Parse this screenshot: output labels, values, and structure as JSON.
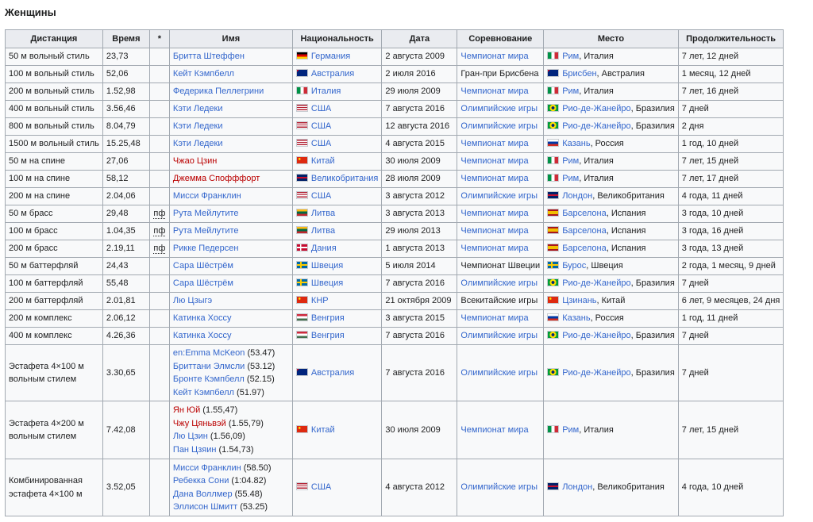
{
  "section": {
    "title": "Женщины"
  },
  "table": {
    "headers": [
      "Дистанция",
      "Время",
      "*",
      "Имя",
      "Национальность",
      "Дата",
      "Соревнование",
      "Место",
      "Продолжительность"
    ],
    "rows": [
      {
        "dist": "50 м вольный стиль",
        "time": "23,73",
        "note": "",
        "names": [
          {
            "t": "Бритта Штеффен",
            "c": "link"
          }
        ],
        "nat_flag": "de",
        "nat": "Германия",
        "date": "2 августа 2009",
        "comp": "Чемпионат мира",
        "comp_link": true,
        "place_flag": "it",
        "city": "Рим",
        "country": ", Италия",
        "dur": "7 лет, 12 дней"
      },
      {
        "dist": "100 м вольный стиль",
        "time": "52,06",
        "note": "",
        "names": [
          {
            "t": "Кейт Кэмпбелл",
            "c": "link"
          }
        ],
        "nat_flag": "au",
        "nat": "Австралия",
        "date": "2 июля 2016",
        "comp": "Гран-при Брисбена",
        "comp_link": false,
        "place_flag": "au",
        "city": "Брисбен",
        "country": ", Австралия",
        "dur": "1 месяц, 12 дней"
      },
      {
        "dist": "200 м вольный стиль",
        "time": "1.52,98",
        "note": "",
        "names": [
          {
            "t": "Федерика Пеллегрини",
            "c": "link"
          }
        ],
        "nat_flag": "it",
        "nat": "Италия",
        "date": "29 июля 2009",
        "comp": "Чемпионат мира",
        "comp_link": true,
        "place_flag": "it",
        "city": "Рим",
        "country": ", Италия",
        "dur": "7 лет, 16 дней"
      },
      {
        "dist": "400 м вольный стиль",
        "time": "3.56,46",
        "note": "",
        "names": [
          {
            "t": "Кэти Ледеки",
            "c": "link"
          }
        ],
        "nat_flag": "us",
        "nat": "США",
        "date": "7 августа 2016",
        "comp": "Олимпийские игры",
        "comp_link": true,
        "place_flag": "br",
        "city": "Рио-де-Жанейро",
        "country": ", Бразилия",
        "dur": "7 дней"
      },
      {
        "dist": "800 м вольный стиль",
        "time": "8.04,79",
        "note": "",
        "names": [
          {
            "t": "Кэти Ледеки",
            "c": "link"
          }
        ],
        "nat_flag": "us",
        "nat": "США",
        "date": "12 августа 2016",
        "comp": "Олимпийские игры",
        "comp_link": true,
        "place_flag": "br",
        "city": "Рио-де-Жанейро",
        "country": ", Бразилия",
        "dur": "2 дня"
      },
      {
        "dist": "1500 м вольный стиль",
        "time": "15.25,48",
        "note": "",
        "names": [
          {
            "t": "Кэти Ледеки",
            "c": "link"
          }
        ],
        "nat_flag": "us",
        "nat": "США",
        "date": "4 августа 2015",
        "comp": "Чемпионат мира",
        "comp_link": true,
        "place_flag": "ru",
        "city": "Казань",
        "country": ", Россия",
        "dur": "1 год, 10 дней"
      },
      {
        "dist": "50 м на спине",
        "time": "27,06",
        "note": "",
        "names": [
          {
            "t": "Чжао Цзин",
            "c": "red"
          }
        ],
        "nat_flag": "cn",
        "nat": "Китай",
        "date": "30 июля 2009",
        "comp": "Чемпионат мира",
        "comp_link": true,
        "place_flag": "it",
        "city": "Рим",
        "country": ", Италия",
        "dur": "7 лет, 15 дней"
      },
      {
        "dist": "100 м на спине",
        "time": "58,12",
        "note": "",
        "names": [
          {
            "t": "Джемма Спофффорт",
            "c": "red"
          }
        ],
        "nat_flag": "gb",
        "nat": "Великобритания",
        "date": "28 июля 2009",
        "comp": "Чемпионат мира",
        "comp_link": true,
        "place_flag": "it",
        "city": "Рим",
        "country": ", Италия",
        "dur": "7 лет, 17 дней"
      },
      {
        "dist": "200 м на спине",
        "time": "2.04,06",
        "note": "",
        "names": [
          {
            "t": "Мисси Франклин",
            "c": "link"
          }
        ],
        "nat_flag": "us",
        "nat": "США",
        "date": "3 августа 2012",
        "comp": "Олимпийские игры",
        "comp_link": true,
        "place_flag": "gb",
        "city": "Лондон",
        "country": ", Великобритания",
        "dur": "4 года, 11 дней"
      },
      {
        "dist": "50 м брасс",
        "time": "29,48",
        "note": "пф",
        "names": [
          {
            "t": "Рута Мейлутите",
            "c": "link"
          }
        ],
        "nat_flag": "lt",
        "nat": "Литва",
        "date": "3 августа 2013",
        "comp": "Чемпионат мира",
        "comp_link": true,
        "place_flag": "es",
        "city": "Барселона",
        "country": ", Испания",
        "dur": "3 года, 10 дней"
      },
      {
        "dist": "100 м брасс",
        "time": "1.04,35",
        "note": "пф",
        "names": [
          {
            "t": "Рута Мейлутите",
            "c": "link"
          }
        ],
        "nat_flag": "lt",
        "nat": "Литва",
        "date": "29 июля 2013",
        "comp": "Чемпионат мира",
        "comp_link": true,
        "place_flag": "es",
        "city": "Барселона",
        "country": ", Испания",
        "dur": "3 года, 16 дней"
      },
      {
        "dist": "200 м брасс",
        "time": "2.19,11",
        "note": "пф",
        "names": [
          {
            "t": "Рикке Педерсен",
            "c": "link"
          }
        ],
        "nat_flag": "dk",
        "nat": "Дания",
        "date": "1 августа 2013",
        "comp": "Чемпионат мира",
        "comp_link": true,
        "place_flag": "es",
        "city": "Барселона",
        "country": ", Испания",
        "dur": "3 года, 13 дней"
      },
      {
        "dist": "50 м баттерфляй",
        "time": "24,43",
        "note": "",
        "names": [
          {
            "t": "Сара Шёстрём",
            "c": "link"
          }
        ],
        "nat_flag": "se",
        "nat": "Швеция",
        "date": "5 июля 2014",
        "comp": "Чемпионат Швеции",
        "comp_link": false,
        "place_flag": "se",
        "city": "Бурос",
        "country": ", Швеция",
        "dur": "2 года, 1 месяц, 9 дней"
      },
      {
        "dist": "100 м баттерфляй",
        "time": "55,48",
        "note": "",
        "names": [
          {
            "t": "Сара Шёстрём",
            "c": "link"
          }
        ],
        "nat_flag": "se",
        "nat": "Швеция",
        "date": "7 августа 2016",
        "comp": "Олимпийские игры",
        "comp_link": true,
        "place_flag": "br",
        "city": "Рио-де-Жанейро",
        "country": ", Бразилия",
        "dur": "7 дней"
      },
      {
        "dist": "200 м баттерфляй",
        "time": "2.01,81",
        "note": "",
        "names": [
          {
            "t": "Лю Цзыгэ",
            "c": "link"
          }
        ],
        "nat_flag": "cn",
        "nat": "КНР",
        "date": "21 октября 2009",
        "comp": "Всекитайские игры",
        "comp_link": false,
        "place_flag": "cn",
        "city": "Цзинань",
        "country": ", Китай",
        "dur": "6 лет, 9 месяцев, 24 дня"
      },
      {
        "dist": "200 м комплекс",
        "time": "2.06,12",
        "note": "",
        "names": [
          {
            "t": "Катинка Хоссу",
            "c": "link"
          }
        ],
        "nat_flag": "hu",
        "nat": "Венгрия",
        "date": "3 августа 2015",
        "comp": "Чемпионат мира",
        "comp_link": true,
        "place_flag": "ru",
        "city": "Казань",
        "country": ", Россия",
        "dur": "1 год, 11 дней"
      },
      {
        "dist": "400 м комплекс",
        "time": "4.26,36",
        "note": "",
        "names": [
          {
            "t": "Катинка Хоссу",
            "c": "link"
          }
        ],
        "nat_flag": "hu",
        "nat": "Венгрия",
        "date": "7 августа 2016",
        "comp": "Олимпийские игры",
        "comp_link": true,
        "place_flag": "br",
        "city": "Рио-де-Жанейро",
        "country": ", Бразилия",
        "dur": "7 дней"
      },
      {
        "dist": "Эстафета 4×100 м вольным стилем",
        "time": "3.30,65",
        "note": "",
        "names": [
          {
            "t": "en:Emma McKeon",
            "c": "link",
            "s": " (53.47)"
          },
          {
            "t": "Бриттани Элмсли",
            "c": "link",
            "s": " (53.12)"
          },
          {
            "t": "Бронте Кэмпбелл",
            "c": "link",
            "s": " (52.15)"
          },
          {
            "t": "Кейт Кэмпбелл",
            "c": "link",
            "s": " (51.97)"
          }
        ],
        "nat_flag": "au",
        "nat": "Австралия",
        "date": "7 августа 2016",
        "comp": "Олимпийские игры",
        "comp_link": true,
        "place_flag": "br",
        "city": "Рио-де-Жанейро",
        "country": ", Бразилия",
        "dur": "7 дней"
      },
      {
        "dist": "Эстафета 4×200 м вольным стилем",
        "time": "7.42,08",
        "note": "",
        "names": [
          {
            "t": "Ян Юй",
            "c": "red",
            "s": " (1.55,47)"
          },
          {
            "t": "Чжу Цяньвэй",
            "c": "red",
            "s": " (1.55,79)"
          },
          {
            "t": "Лю Цзин",
            "c": "link",
            "s": " (1.56,09)"
          },
          {
            "t": "Пан Цзяин",
            "c": "link",
            "s": " (1.54,73)"
          }
        ],
        "nat_flag": "cn",
        "nat": "Китай",
        "date": "30 июля 2009",
        "comp": "Чемпионат мира",
        "comp_link": true,
        "place_flag": "it",
        "city": "Рим",
        "country": ", Италия",
        "dur": "7 лет, 15 дней"
      },
      {
        "dist": "Комбинированная эстафета 4×100 м",
        "time": "3.52,05",
        "note": "",
        "names": [
          {
            "t": "Мисси Франклин",
            "c": "link",
            "s": " (58.50)"
          },
          {
            "t": "Ребекка Сони",
            "c": "link",
            "s": " (1:04.82)"
          },
          {
            "t": "Дана Воллмер",
            "c": "link",
            "s": " (55.48)"
          },
          {
            "t": "Эллисон Шмитт",
            "c": "link",
            "s": " (53.25)"
          }
        ],
        "nat_flag": "us",
        "nat": "США",
        "date": "4 августа 2012",
        "comp": "Олимпийские игры",
        "comp_link": true,
        "place_flag": "gb",
        "city": "Лондон",
        "country": ", Великобритания",
        "dur": "4 года, 10 дней"
      }
    ]
  }
}
